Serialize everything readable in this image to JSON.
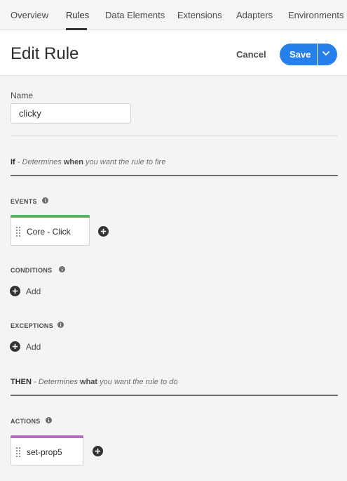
{
  "nav": {
    "tabs": [
      {
        "label": "Overview"
      },
      {
        "label": "Rules"
      },
      {
        "label": "Data Elements"
      },
      {
        "label": "Extensions"
      },
      {
        "label": "Adapters"
      },
      {
        "label": "Environments"
      }
    ],
    "active_tab": "Rules"
  },
  "header": {
    "title": "Edit Rule",
    "cancel_label": "Cancel",
    "save_label": "Save"
  },
  "form": {
    "name_label": "Name",
    "name_value": "clicky"
  },
  "if_clause": {
    "keyword": "If",
    "text_before": " - Determines ",
    "emphasis": "when",
    "text_after": " you want the rule to fire"
  },
  "events": {
    "label": "EVENTS",
    "items": [
      {
        "label": "Core - Click",
        "bar_color": "#5bb05b"
      }
    ]
  },
  "conditions": {
    "label": "CONDITIONS",
    "add_label": "Add"
  },
  "exceptions": {
    "label": "EXCEPTIONS",
    "add_label": "Add"
  },
  "then_clause": {
    "keyword": "THEN",
    "text_before": " - Determines ",
    "emphasis": "what",
    "text_after": " you want the rule to do"
  },
  "actions": {
    "label": "ACTIONS",
    "items": [
      {
        "label": "set-prop5",
        "bar_color": "#b36cc0"
      }
    ]
  },
  "colors": {
    "accent": "#2680eb",
    "event_bar": "#5bb05b",
    "action_bar": "#b36cc0"
  }
}
